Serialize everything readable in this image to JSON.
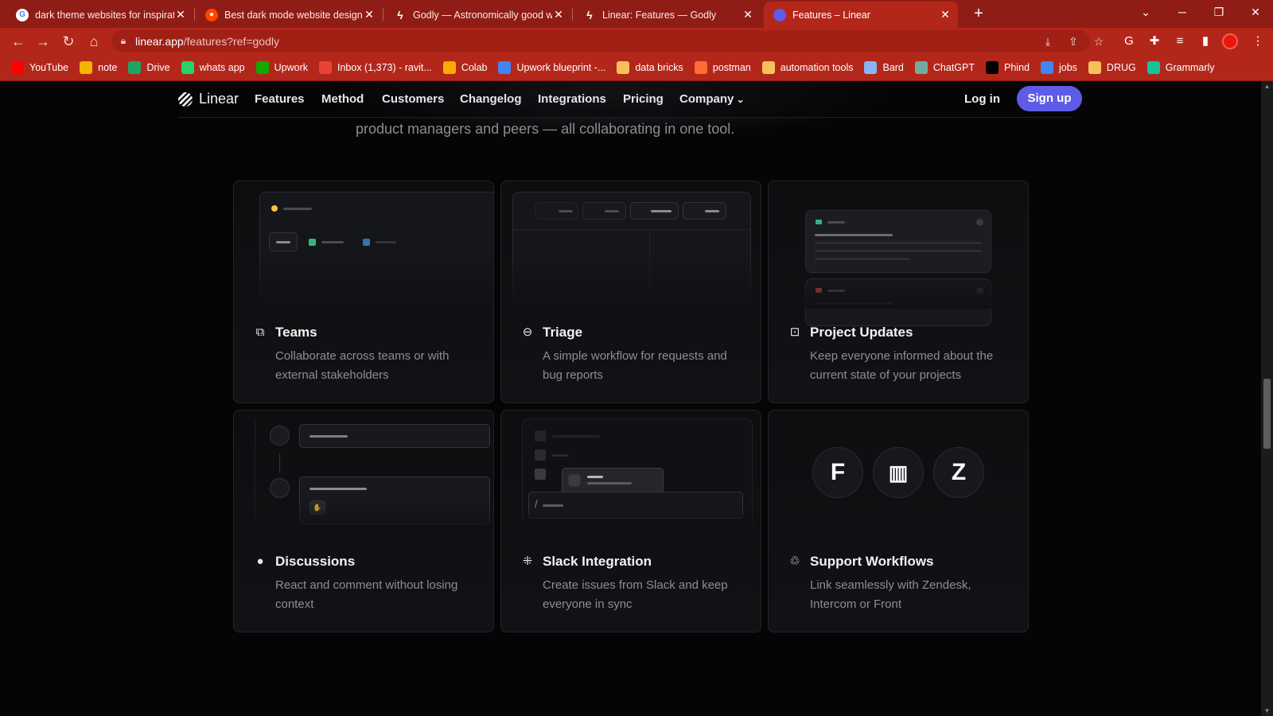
{
  "tabs": [
    {
      "title": "dark theme websites for inspiratio",
      "icon": "google-icon",
      "color": "#ffffff"
    },
    {
      "title": "Best dark mode website designs?",
      "icon": "reddit-icon",
      "color": "#ff4500"
    },
    {
      "title": "Godly — Astronomically good w",
      "icon": "bolt-icon",
      "color": "#ffffff"
    },
    {
      "title": "Linear: Features — Godly",
      "icon": "bolt-icon",
      "color": "#ffffff"
    },
    {
      "title": "Features – Linear",
      "icon": "linear-icon",
      "color": "#5e5be6"
    }
  ],
  "url": {
    "host": "linear.app",
    "path": "/features?ref=godly"
  },
  "bookmarks": [
    {
      "label": "YouTube",
      "icon": "youtube-icon",
      "color": "#ff0000"
    },
    {
      "label": "note",
      "icon": "note-icon",
      "color": "#f4b400"
    },
    {
      "label": "Drive",
      "icon": "drive-icon",
      "color": "#1fa463"
    },
    {
      "label": "whats app",
      "icon": "whatsapp-icon",
      "color": "#25d366"
    },
    {
      "label": "Upwork",
      "icon": "upwork-icon",
      "color": "#14a800"
    },
    {
      "label": "Inbox (1,373) - ravit...",
      "icon": "gmail-icon",
      "color": "#ea4335"
    },
    {
      "label": "Colab",
      "icon": "colab-icon",
      "color": "#f9ab00"
    },
    {
      "label": "Upwork blueprint -...",
      "icon": "docs-icon",
      "color": "#4285f4"
    },
    {
      "label": "data bricks",
      "icon": "folder-icon",
      "color": "#f6c15b"
    },
    {
      "label": "postman",
      "icon": "postman-icon",
      "color": "#ff6c37"
    },
    {
      "label": "automation tools",
      "icon": "folder-icon",
      "color": "#f6c15b"
    },
    {
      "label": "Bard",
      "icon": "bard-icon",
      "color": "#8ab4f8"
    },
    {
      "label": "ChatGPT",
      "icon": "chatgpt-icon",
      "color": "#74aa9c"
    },
    {
      "label": "Phind",
      "icon": "phind-icon",
      "color": "#000000"
    },
    {
      "label": "jobs",
      "icon": "docs-icon",
      "color": "#4285f4"
    },
    {
      "label": "DRUG",
      "icon": "folder-icon",
      "color": "#f6c15b"
    },
    {
      "label": "Grammarly",
      "icon": "grammarly-icon",
      "color": "#15c39a"
    }
  ],
  "site": {
    "brand": "Linear",
    "nav": [
      "Features",
      "Method",
      "Customers",
      "Changelog",
      "Integrations",
      "Pricing",
      "Company"
    ],
    "login": "Log in",
    "signup": "Sign up",
    "accent": "#5e5be6",
    "subtitle": "product managers and peers — all collaborating in one tool."
  },
  "features": [
    {
      "title": "Teams",
      "desc": "Collaborate across teams or with external stakeholders",
      "icon": "teams-icon"
    },
    {
      "title": "Triage",
      "desc": "A simple workflow for requests and bug reports",
      "icon": "triage-icon"
    },
    {
      "title": "Project Updates",
      "desc": "Keep everyone informed about the current state of your projects",
      "icon": "pulse-icon"
    },
    {
      "title": "Discussions",
      "desc": "React and comment without losing context",
      "icon": "chat-bubble-icon"
    },
    {
      "title": "Slack Integration",
      "desc": "Create issues from Slack and keep everyone in sync",
      "icon": "slack-icon"
    },
    {
      "title": "Support Workflows",
      "desc": "Link seamlessly with Zendesk, Intercom or Front",
      "icon": "recycle-icon"
    }
  ],
  "support_logos": [
    {
      "name": "front-logo-icon",
      "glyph": "F"
    },
    {
      "name": "intercom-logo-icon",
      "glyph": "▥"
    },
    {
      "name": "zendesk-logo-icon",
      "glyph": "Z"
    }
  ]
}
